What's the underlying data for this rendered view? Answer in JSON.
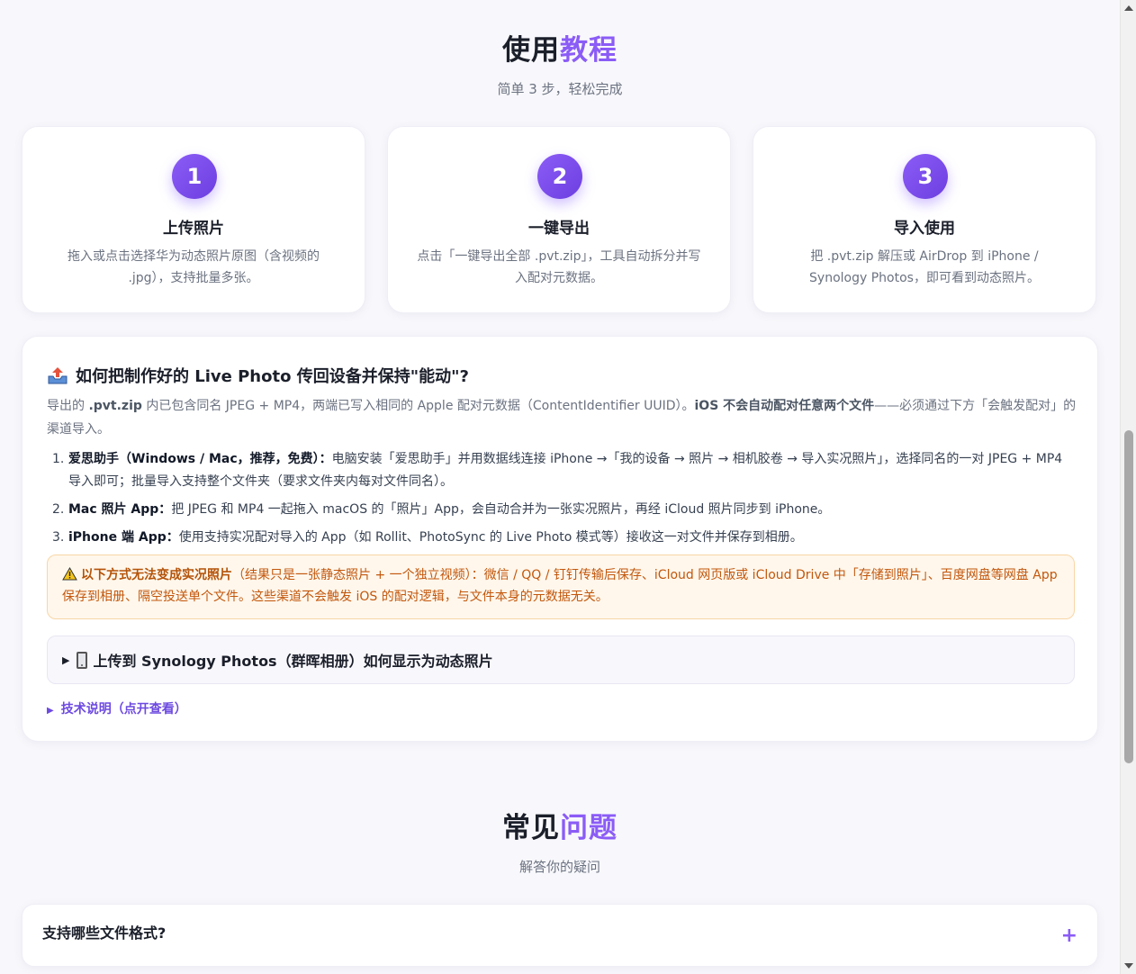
{
  "tutorial": {
    "title_main": "使用",
    "title_accent": "教程",
    "subtitle": "简单 3 步，轻松完成",
    "steps": [
      {
        "num": "1",
        "title": "上传照片",
        "desc": "拖入或点击选择华为动态照片原图（含视频的 .jpg），支持批量多张。"
      },
      {
        "num": "2",
        "title": "一键导出",
        "desc": "点击「一键导出全部 .pvt.zip」，工具自动拆分并写入配对元数据。"
      },
      {
        "num": "3",
        "title": "导入使用",
        "desc": "把 .pvt.zip 解压或 AirDrop 到 iPhone / Synology Photos，即可看到动态照片。"
      }
    ]
  },
  "guide": {
    "title": "如何把制作好的 Live Photo 传回设备并保持\"能动\"?",
    "intro_1": "导出的 ",
    "intro_2": ".pvt.zip",
    "intro_3": " 内已包含同名 JPEG + MP4，两端已写入相同的 Apple 配对元数据（ContentIdentifier UUID）。",
    "intro_4": "iOS 不会自动配对任意两个文件",
    "intro_5": "——必须通过下方「会触发配对」的渠道导入。",
    "items": [
      {
        "num": "1.",
        "bold": "爱思助手（Windows / Mac，推荐，免费）：",
        "text": "电脑安装「爱思助手」并用数据线连接 iPhone →「我的设备 → 照片 → 相机胶卷 → 导入实况照片」，选择同名的一对 JPEG + MP4 导入即可；批量导入支持整个文件夹（要求文件夹内每对文件同名）。"
      },
      {
        "num": "2.",
        "bold": "Mac 照片 App：",
        "text": "把 JPEG 和 MP4 一起拖入 macOS 的「照片」App，会自动合并为一张实况照片，再经 iCloud 照片同步到 iPhone。"
      },
      {
        "num": "3.",
        "bold": "iPhone 端 App：",
        "text": "使用支持实况配对导入的 App（如 Rollit、PhotoSync 的 Live Photo 模式等）接收这一对文件并保存到相册。"
      }
    ],
    "warning_bold": "以下方式无法变成实况照片",
    "warning_text": "（结果只是一张静态照片 + 一个独立视频）：微信 / QQ / 钉钉传输后保存、iCloud 网页版或 iCloud Drive 中「存储到照片」、百度网盘等网盘 App 保存到相册、隔空投送单个文件。这些渠道不会触发 iOS 的配对逻辑，与文件本身的元数据无关。",
    "synology_label": "上传到 Synology Photos（群晖相册）如何显示为动态照片",
    "tech_label": "技术说明（点开查看）",
    "triangle": "▶"
  },
  "faq": {
    "title_main": "常见",
    "title_accent": "问题",
    "subtitle": "解答你的疑问",
    "items": [
      {
        "question": "支持哪些文件格式?",
        "icon": "+"
      }
    ]
  },
  "colors": {
    "accent": "#8b5cf6",
    "warning_text": "#c2570c",
    "warning_bg": "#fff7ec"
  }
}
